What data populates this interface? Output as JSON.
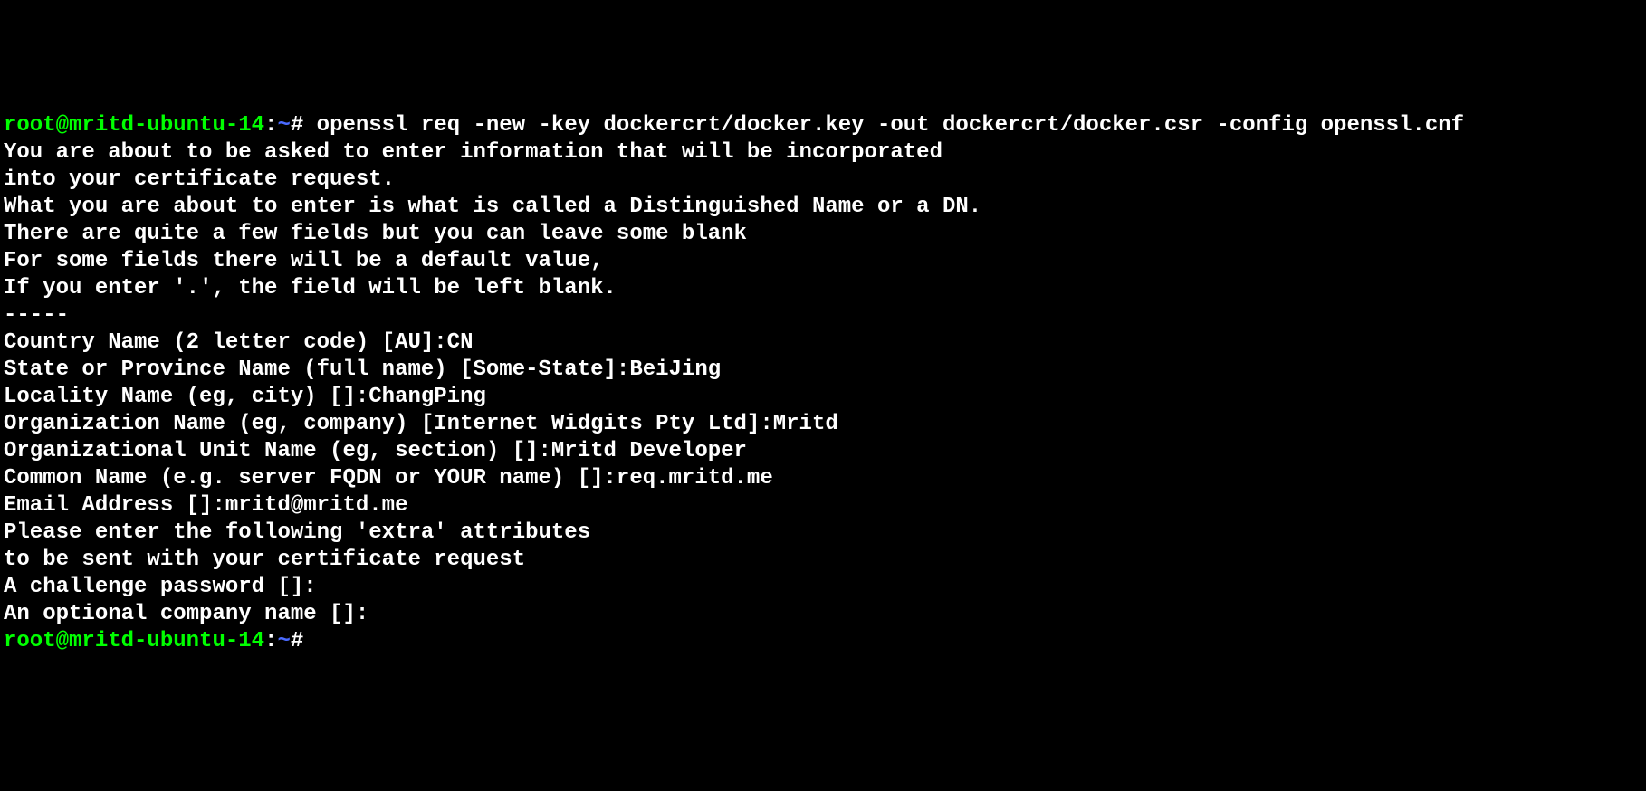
{
  "prompt1": {
    "user": "root@mritd-ubuntu-14",
    "sep": ":",
    "path": "~",
    "hash": "# "
  },
  "command": "openssl req -new -key dockercrt/docker.key -out dockercrt/docker.csr -config openssl.cnf",
  "lines": {
    "l1": "You are about to be asked to enter information that will be incorporated",
    "l2": "into your certificate request.",
    "l3": "What you are about to enter is what is called a Distinguished Name or a DN.",
    "l4": "There are quite a few fields but you can leave some blank",
    "l5": "For some fields there will be a default value,",
    "l6": "If you enter '.', the field will be left blank.",
    "l7": "-----",
    "l8": "Country Name (2 letter code) [AU]:CN",
    "l9": "State or Province Name (full name) [Some-State]:BeiJing",
    "l10": "Locality Name (eg, city) []:ChangPing",
    "l11": "Organization Name (eg, company) [Internet Widgits Pty Ltd]:Mritd",
    "l12": "Organizational Unit Name (eg, section) []:Mritd Developer",
    "l13": "Common Name (e.g. server FQDN or YOUR name) []:req.mritd.me",
    "l14": "Email Address []:mritd@mritd.me",
    "l15": "",
    "l16": "Please enter the following 'extra' attributes",
    "l17": "to be sent with your certificate request",
    "l18": "A challenge password []:",
    "l19": "An optional company name []:"
  },
  "prompt2": {
    "user": "root@mritd-ubuntu-14",
    "sep": ":",
    "path": "~",
    "hash": "#"
  }
}
